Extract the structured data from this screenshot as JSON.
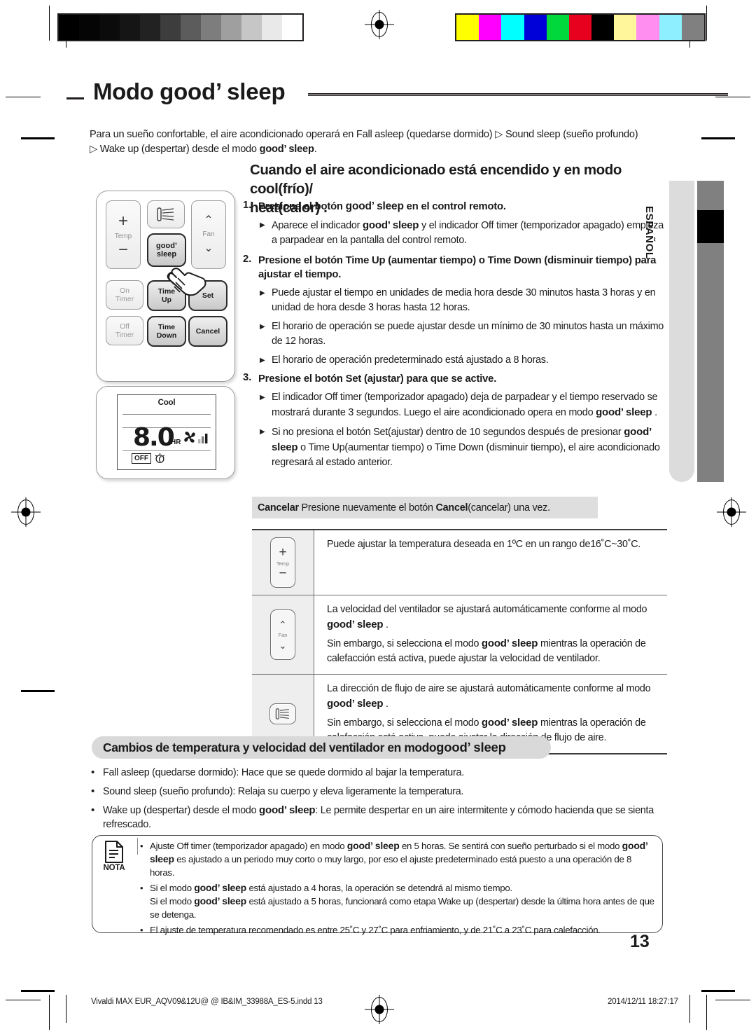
{
  "header": {
    "title_plain": "Modo ",
    "title_brand": "good’ sleep"
  },
  "lead": {
    "line1": "Para un sueño confortable, el aire acondicionado operará en Fall asleep (quedarse dormido) ▷ Sound sleep (sueño profundo)",
    "line2_pre": "▷ Wake up (despertar) desde el modo ",
    "line2_brand": "good’ sleep",
    "line2_post": "."
  },
  "section": {
    "heading_line1": "Cuando el aire acondicionado está encendido y en modo cool(frío)/",
    "heading_line2": "heat(calor) ."
  },
  "steps": [
    {
      "num": "1.",
      "pre": "Presione el botón ",
      "brand": "good’ sleep",
      "post": " en el control remoto.",
      "subs": [
        {
          "pre": "Aparece el indicador ",
          "brand": "good’ sleep",
          "post": " y el indicador Off timer (temporizador apagado) empieza a parpadear en la pantalla del control remoto."
        }
      ]
    },
    {
      "num": "2.",
      "pre": "Presione el botón Time Up (aumentar tiempo) o Time Down (disminuir tiempo) para ajustar el tiempo.",
      "brand": "",
      "post": "",
      "subs": [
        {
          "pre": "Puede ajustar el tiempo en unidades de media hora desde 30 minutos hasta 3 horas y en unidad de hora desde 3 horas hasta 12 horas.",
          "brand": "",
          "post": ""
        },
        {
          "pre": "El horario de operación se puede ajustar desde un mínimo de 30 minutos hasta un máximo de 12 horas.",
          "brand": "",
          "post": ""
        },
        {
          "pre": "El horario de operación predeterminado está ajustado a 8 horas.",
          "brand": "",
          "post": ""
        }
      ]
    },
    {
      "num": "3.",
      "pre": "Presione el botón Set (ajustar) para que se active.",
      "brand": "",
      "post": "",
      "subs": [
        {
          "pre": "El indicador Off timer (temporizador apagado) deja de parpadear y el tiempo reservado se mostrará durante 3 segundos. Luego el aire acondicionado opera en modo ",
          "brand": "good’ sleep",
          "post": " ."
        },
        {
          "pre": "Si no presiona el botón Set(ajustar) dentro de 10 segundos después de presionar ",
          "brand": "good’ sleep",
          "post": " o Time Up(aumentar tiempo) o Time Down (disminuir tiempo), el aire acondicionado regresará al estado anterior."
        }
      ]
    }
  ],
  "cancel_bar": {
    "label": "Cancelar",
    "text_pre": "Presione nuevamente el botón ",
    "button": "Cancel",
    "text_post": "(cancelar) una vez."
  },
  "feature_table": [
    {
      "icon": "temp-key-icon",
      "icon_labels": {
        "plus": "+",
        "caption": "Temp",
        "minus": "−"
      },
      "lines": [
        "Puede ajustar la temperatura deseada en 1ºC en un rango de16˚C~30˚C."
      ]
    },
    {
      "icon": "fan-key-icon",
      "icon_labels": {
        "up": "⌃",
        "caption": "Fan",
        "down": "⌄"
      },
      "lines_rich": [
        {
          "pre": "La velocidad del ventilador se ajustará automáticamente conforme al modo ",
          "brand": "good’ sleep",
          "post": " ."
        },
        {
          "pre": "Sin embargo, si selecciona el modo ",
          "brand": "good’ sleep",
          "post": " mientras la operación de calefacción está activa, puede ajustar la velocidad de ventilador."
        }
      ]
    },
    {
      "icon": "airflow-key-icon",
      "icon_labels": {},
      "lines_rich": [
        {
          "pre": "La dirección de flujo de aire se ajustará automáticamente conforme al modo ",
          "brand": "good’ sleep",
          "post": " ."
        },
        {
          "pre": "Sin embargo, si selecciona el modo ",
          "brand": "good’ sleep",
          "post": " mientras la operación de calefacción está activa, puede ajustar la dirección de flujo de aire."
        }
      ]
    }
  ],
  "subsection": {
    "heading_pre": "Cambios de temperatura y velocidad del ventilador en modo ",
    "heading_brand": "good’ sleep"
  },
  "bullets": [
    {
      "pre": "Fall asleep (quedarse dormido): Hace que se quede dormido al bajar la temperatura.",
      "brand": "",
      "post": ""
    },
    {
      "pre": "Sound sleep (sueño profundo): Relaja su cuerpo y eleva ligeramente la temperatura.",
      "brand": "",
      "post": ""
    },
    {
      "pre": "Wake up (despertar) desde el modo ",
      "brand": "good’ sleep",
      "post": ": Le permite despertar en un aire intermitente y cómodo hacienda que se sienta refrescado."
    }
  ],
  "nota": {
    "label": "NOTA",
    "items": [
      {
        "pre": "Ajuste Off timer (temporizador apagado) en modo ",
        "brand": "good’ sleep",
        "mid": " en 5 horas. Se sentirá con sueño perturbado si el modo ",
        "brand2": "good’ sleep",
        "post": " es ajustado a un periodo muy corto o muy largo, por eso el ajuste predeterminado está puesto a una operación de 8 horas."
      },
      {
        "pre": "Si el modo ",
        "brand": "good’ sleep",
        "mid": " está ajustado a 4 horas, la operación se detendrá al mismo tiempo.",
        "brand2": "good’ sleep",
        "post": "",
        "line2_pre": "Si el modo ",
        "line2_post": " está ajustado a 5 horas, funcionará como etapa Wake up (despertar) desde la última hora antes de que se detenga."
      },
      {
        "pre": "El ajuste de temperatura recomendado es entre 25˚C y 27˚C para enfriamiento, y de 21˚C a 23˚C para calefacción.",
        "brand": "",
        "mid": "",
        "brand2": "",
        "post": ""
      }
    ]
  },
  "page_number": "13",
  "side_tab": {
    "language": "ESPAÑOL"
  },
  "footer": {
    "file": "Vivaldi MAX EUR_AQV09&12U@ @ IB&IM_33988A_ES-5.indd   13",
    "timestamp": "2014/12/11   18:27:17"
  },
  "remote": {
    "buttons": {
      "temp_plus": "+",
      "temp_label": "Temp",
      "temp_minus": "−",
      "airflow": "airflow-icon",
      "fan_up": "⌃",
      "fan_label": "Fan",
      "fan_down": "⌄",
      "good_sleep_l1": "good’",
      "good_sleep_l2": "sleep",
      "on_timer_l1": "On",
      "on_timer_l2": "Timer",
      "time_up_l1": "Time",
      "time_up_l2": "Up",
      "set": "Set",
      "off_timer_l1": "Off",
      "off_timer_l2": "Timer",
      "time_down_l1": "Time",
      "time_down_l2": "Down",
      "cancel": "Cancel"
    }
  },
  "lcd": {
    "mode": "Cool",
    "value": "8.0",
    "unit": "HR",
    "off_tag": "OFF",
    "fan_icon": "fan-blades-icon",
    "sleep_icon": "moon-sleep-icon"
  },
  "colorbars": {
    "grayscale": [
      "#000000",
      "#050505",
      "#0b0b0b",
      "#151515",
      "#222222",
      "#3d3d3d",
      "#5c5c5c",
      "#7d7d7d",
      "#9f9f9f",
      "#c6c6c6",
      "#e9e9e9",
      "#ffffff"
    ],
    "colors": [
      "#ffff00",
      "#ff00ff",
      "#00ffff",
      "#0000d8",
      "#00d83c",
      "#e8001f",
      "#000000",
      "#fff59a",
      "#ff8ef0",
      "#8ef0ff",
      "#808080"
    ]
  }
}
